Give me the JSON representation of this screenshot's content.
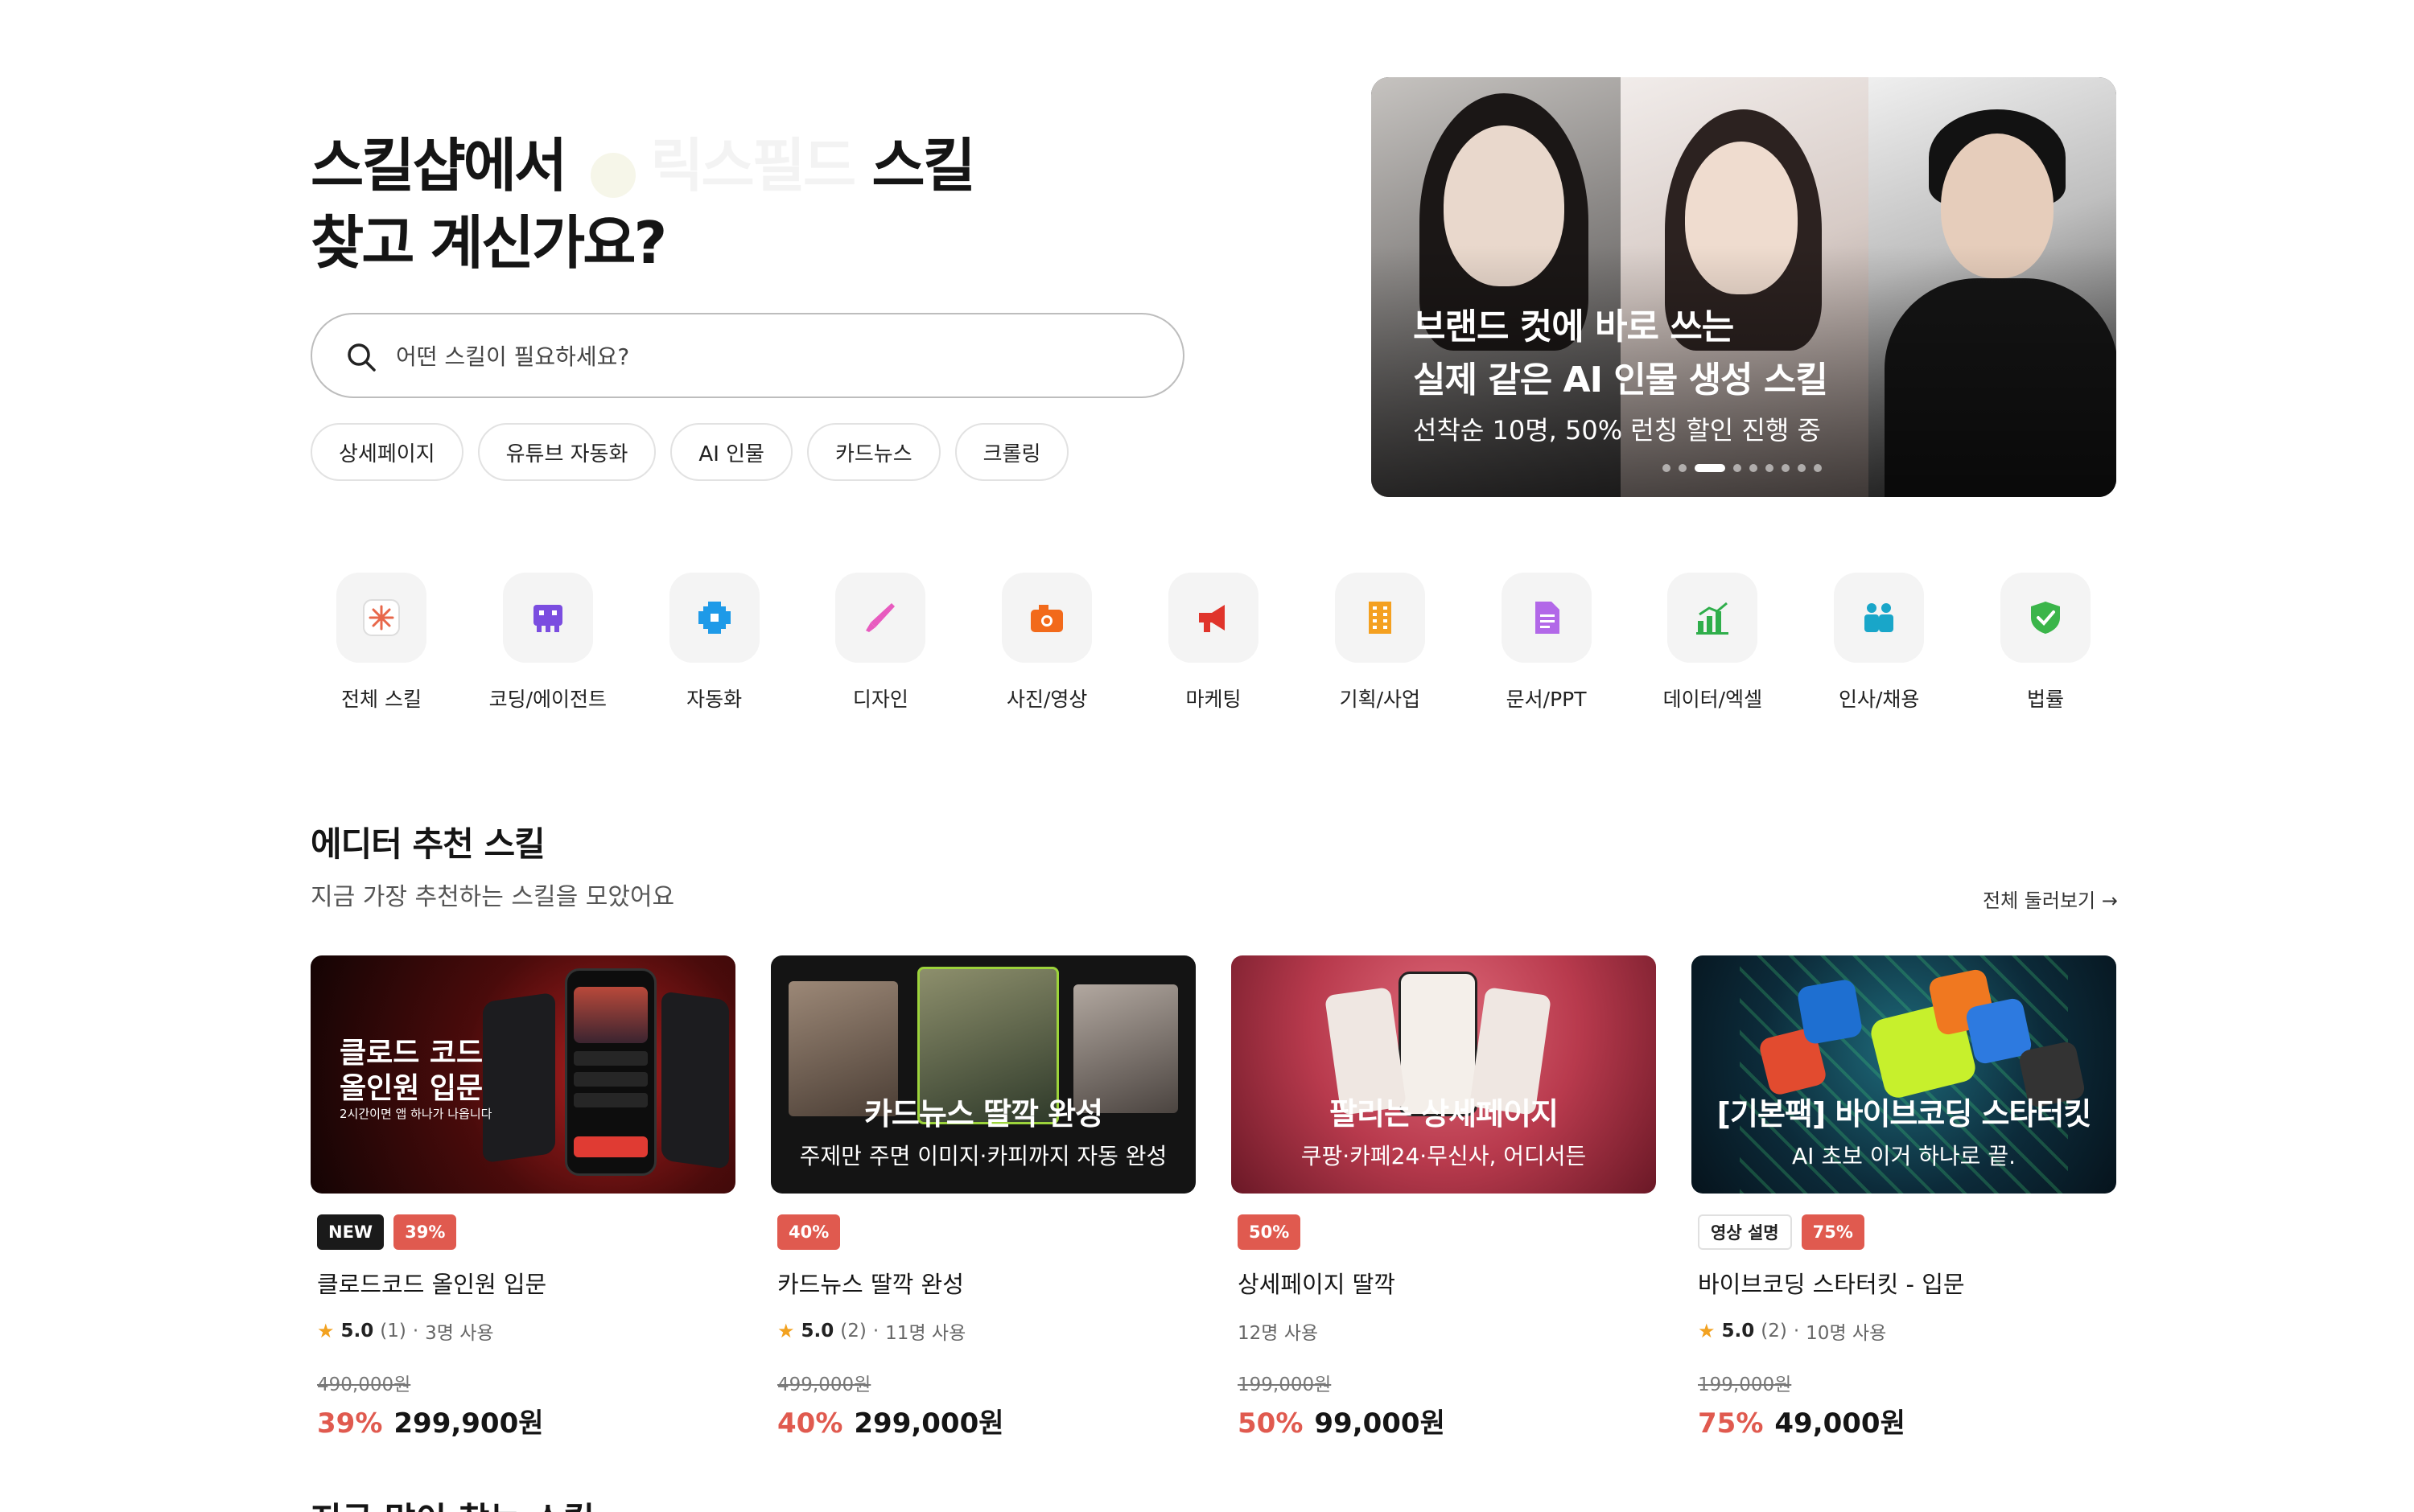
{
  "hero": {
    "title_line1_a": "스킬샵에서",
    "title_line1_ghost": "릭스필드",
    "title_line1_b": "스킬",
    "title_line2": "찾고 계신가요?"
  },
  "search": {
    "placeholder": "어떤 스킬이 필요하세요?"
  },
  "chips": [
    "상세페이지",
    "유튜브 자동화",
    "AI 인물",
    "카드뉴스",
    "크롤링"
  ],
  "banner": {
    "line1": "브랜드 컷에 바로 쓰는",
    "line2": "실제 같은 AI 인물 생성 스킬",
    "sub": "선착순 10명, 50% 런칭 할인 진행 중",
    "slide_count": 9,
    "active_slide": 3
  },
  "categories": [
    {
      "label": "전체 스킬",
      "icon": "asterisk-icon",
      "color": "#e8674a"
    },
    {
      "label": "코딩/에이전트",
      "icon": "robot-icon",
      "color": "#7b4de0"
    },
    {
      "label": "자동화",
      "icon": "gear-icon",
      "color": "#1e9ae8"
    },
    {
      "label": "디자인",
      "icon": "brush-icon",
      "color": "#e85bbf"
    },
    {
      "label": "사진/영상",
      "icon": "camera-icon",
      "color": "#f26a1b"
    },
    {
      "label": "마케팅",
      "icon": "megaphone-icon",
      "color": "#e0342b"
    },
    {
      "label": "기획/사업",
      "icon": "building-icon",
      "color": "#f4a020"
    },
    {
      "label": "문서/PPT",
      "icon": "document-icon",
      "color": "#b268e8"
    },
    {
      "label": "데이터/엑셀",
      "icon": "bar-chart-icon",
      "color": "#2fae4b"
    },
    {
      "label": "인사/채용",
      "icon": "people-icon",
      "color": "#19a6c9"
    },
    {
      "label": "법률",
      "icon": "shield-check-icon",
      "color": "#3bb54a"
    }
  ],
  "section": {
    "title": "에디터 추천 스킬",
    "subtitle": "지금 가장 추천하는 스킬을 모았어요",
    "see_all": "전체 둘러보기 →"
  },
  "cards": [
    {
      "thumb_main": "클로드 코드\n올인원 입문",
      "thumb_main_l1": "클로드 코드",
      "thumb_main_l2": "올인원 입문",
      "thumb_sub": "2시간이면 앱 하나가 나옵니다",
      "badges": [
        {
          "text": "NEW",
          "kind": "new"
        },
        {
          "text": "39%",
          "kind": "disc"
        }
      ],
      "title": "클로드코드 올인원 입문",
      "rating": "5.0",
      "reviews": "(1)",
      "users": "3명 사용",
      "original_price": "490,000원",
      "discount": "39%",
      "price": "299,900원"
    },
    {
      "thumb_main": "카드뉴스 딸깍 완성",
      "thumb_sub": "주제만 주면 이미지·카피까지 자동 완성",
      "badges": [
        {
          "text": "40%",
          "kind": "disc"
        }
      ],
      "title": "카드뉴스 딸깍 완성",
      "rating": "5.0",
      "reviews": "(2)",
      "users": "11명 사용",
      "original_price": "499,000원",
      "discount": "40%",
      "price": "299,000원"
    },
    {
      "thumb_main": "팔리는 상세페이지",
      "thumb_sub": "쿠팡·카페24·무신사, 어디서든",
      "badges": [
        {
          "text": "50%",
          "kind": "disc"
        }
      ],
      "title": "상세페이지 딸깍",
      "rating": "",
      "reviews": "",
      "users": "12명 사용",
      "original_price": "199,000원",
      "discount": "50%",
      "price": "99,000원"
    },
    {
      "thumb_main": "[기본팩] 바이브코딩 스타터킷",
      "thumb_sub": "AI 초보 이거 하나로 끝.",
      "badges": [
        {
          "text": "영상 설명",
          "kind": "outline"
        },
        {
          "text": "75%",
          "kind": "disc"
        }
      ],
      "title": "바이브코딩 스타터킷 - 입문",
      "rating": "5.0",
      "reviews": "(2)",
      "users": "10명 사용",
      "original_price": "199,000원",
      "discount": "75%",
      "price": "49,000원"
    }
  ],
  "next_section_title": "지금 많이 찾는 스킬"
}
